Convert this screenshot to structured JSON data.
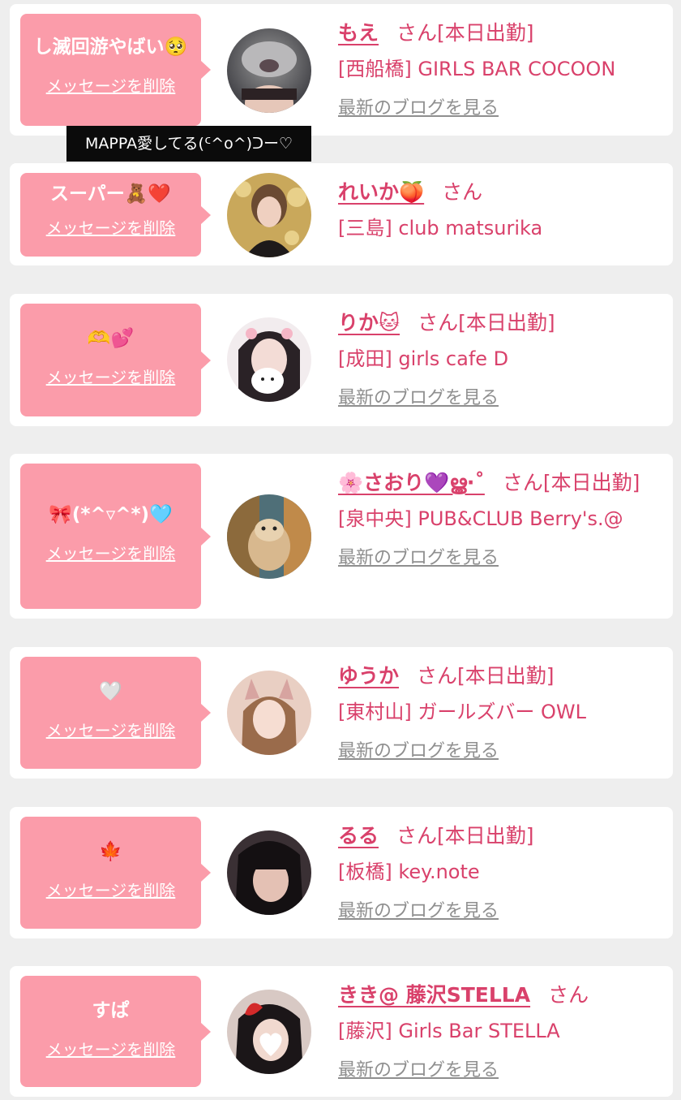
{
  "bubble_delete_label": "メッセージを削除",
  "blog_link_label": "最新のブログを見る",
  "honorific": "さん",
  "tooltip_text": "MAPPA愛してる(ᑦ^o^)ᑐー♡",
  "colors": {
    "background": "#eeeeee",
    "card": "#ffffff",
    "bubble": "#fb9caa",
    "accent_text": "#d9416b",
    "muted_link": "#8f8f8f"
  },
  "entries": [
    {
      "bubble_text": "し滅回游やばい🥺",
      "name": "もえ",
      "status": "[本日出勤]",
      "shop": "[西船橋] GIRLS BAR COCOON",
      "has_blog": true
    },
    {
      "bubble_text": "スーパー🧸❤️",
      "name": "れいか🍑",
      "status": "",
      "shop": "[三島] club matsurika",
      "has_blog": false
    },
    {
      "bubble_text": "🫶💕",
      "name": "りか🐱",
      "status": "[本日出勤]",
      "shop": "[成田] girls cafe D",
      "has_blog": true
    },
    {
      "bubble_text": "🎀(*^▿^*)🩵",
      "name": "🌸さおり💜ൠ·˚",
      "status": "[本日出勤]",
      "shop": "[泉中央] PUB&CLUB Berry's.@",
      "has_blog": true
    },
    {
      "bubble_text": "🤍",
      "name": "ゆうか",
      "status": "[本日出勤]",
      "shop": "[東村山] ガールズバー OWL",
      "has_blog": true
    },
    {
      "bubble_text": "🍁",
      "name": "るる",
      "status": "[本日出勤]",
      "shop": "[板橋] key.note",
      "has_blog": true
    },
    {
      "bubble_text": "すぱ",
      "name": "きき@ 藤沢STELLA",
      "status": "",
      "shop": "[藤沢] Girls Bar STELLA",
      "has_blog": true
    }
  ]
}
